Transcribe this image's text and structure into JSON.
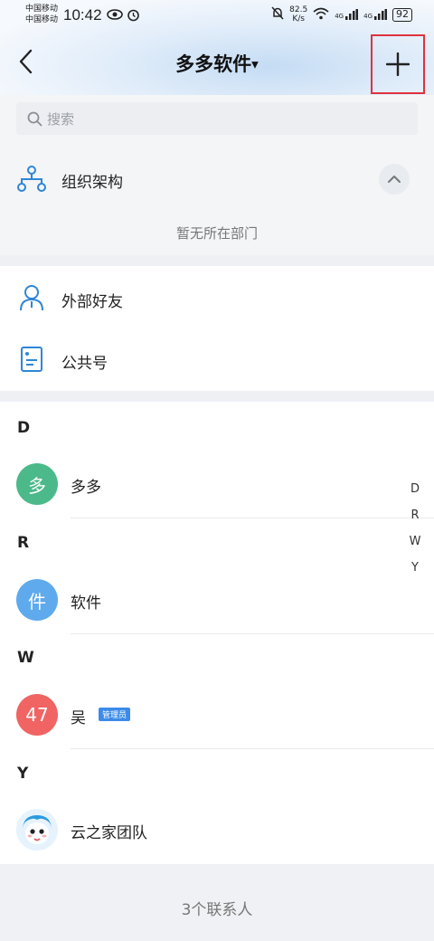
{
  "status_bar": {
    "carrier_1": "中国移动",
    "carrier_2": "中国移动",
    "time": "10:42",
    "speed_value": "82.5",
    "speed_unit": "K/s",
    "net_1": "4G",
    "net_2": "4G",
    "battery": "92"
  },
  "header": {
    "title": "多多软件",
    "back_icon": "chevron-left-icon",
    "add_icon": "plus-icon",
    "highlight_color": "#e0313f"
  },
  "search": {
    "placeholder": "搜索"
  },
  "org": {
    "label": "组织架构",
    "empty_text": "暂无所在部门"
  },
  "entries": [
    {
      "label": "外部好友",
      "icon": "person-icon"
    },
    {
      "label": "公共号",
      "icon": "document-icon"
    }
  ],
  "sections": [
    {
      "letter": "D",
      "contacts": [
        {
          "name": "多多",
          "avatar_text": "多",
          "avatar_color": "#4cb98a"
        }
      ]
    },
    {
      "letter": "R",
      "contacts": [
        {
          "name": "软件",
          "avatar_text": "件",
          "avatar_color": "#5eaaed"
        }
      ]
    },
    {
      "letter": "W",
      "contacts": [
        {
          "name": "吴",
          "avatar_text": "47",
          "avatar_color": "#f06464",
          "badge": "管理员"
        }
      ]
    },
    {
      "letter": "Y",
      "contacts": [
        {
          "name": "云之家团队",
          "avatar_icon": "mascot-avatar-icon"
        }
      ]
    }
  ],
  "index_bar": [
    "D",
    "R",
    "W",
    "Y"
  ],
  "footer": {
    "count_text": "3个联系人"
  },
  "accent_color": "#2f86d6"
}
